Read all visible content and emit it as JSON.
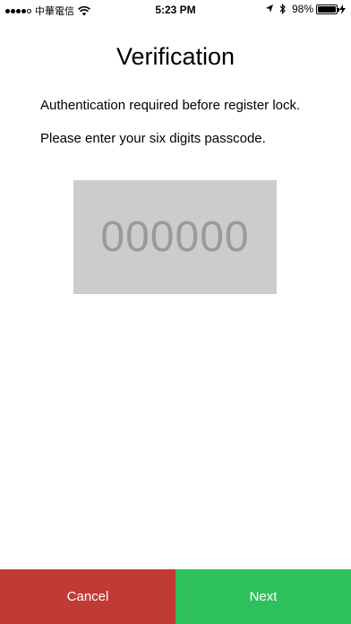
{
  "status_bar": {
    "carrier": "中華電信",
    "time": "5:23 PM",
    "battery_percent": "98%",
    "battery_level": 0.98,
    "signal_bars": 4,
    "signal_max": 5
  },
  "screen": {
    "title": "Verification",
    "message_line1": "Authentication required before register lock.",
    "message_line2": "Please enter your six digits passcode.",
    "passcode_placeholder": "000000",
    "passcode_value": ""
  },
  "buttons": {
    "cancel_label": "Cancel",
    "next_label": "Next"
  },
  "colors": {
    "cancel": "#c23a35",
    "next": "#2ec05c",
    "passcode_bg": "#cccccc"
  },
  "icons": [
    "wifi-icon",
    "location-arrow-icon",
    "bluetooth-icon",
    "battery-icon",
    "charging-bolt-icon"
  ]
}
